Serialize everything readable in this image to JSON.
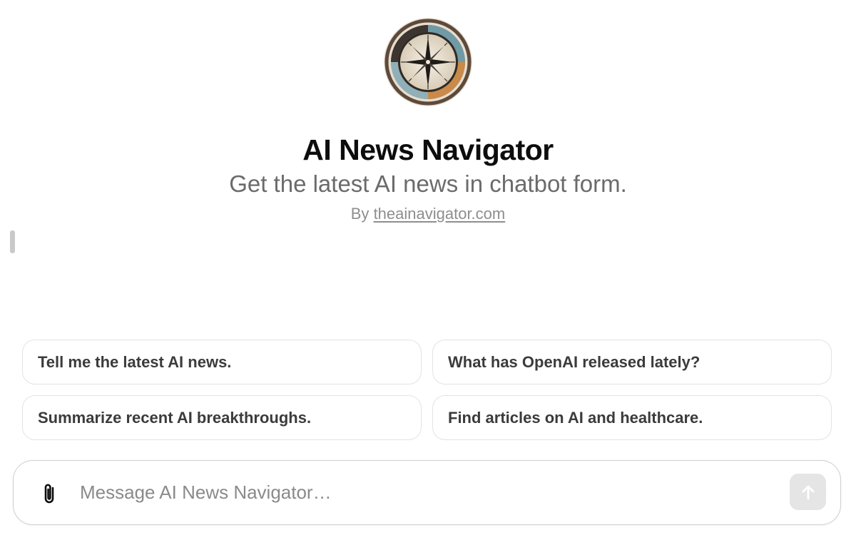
{
  "gpt": {
    "name": "AI News Navigator",
    "description": "Get the latest AI news in chatbot form.",
    "by_prefix": "By",
    "author": "theainavigator.com",
    "avatar_icon": "compass-icon"
  },
  "suggestions": [
    "Tell me the latest AI news.",
    "What has OpenAI released lately?",
    "Summarize recent AI breakthroughs.",
    "Find articles on AI and healthcare."
  ],
  "composer": {
    "placeholder": "Message AI News Navigator…",
    "attach_icon": "paperclip-icon",
    "send_icon": "arrow-up-icon"
  },
  "colors": {
    "title": "#0d0d0d",
    "subtitle": "#6b6b6b",
    "muted": "#8e8e8e",
    "send_disabled": "#e5e5e5"
  }
}
